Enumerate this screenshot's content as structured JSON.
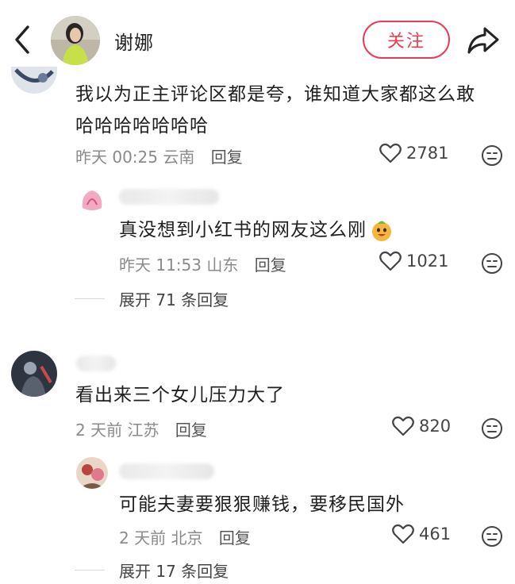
{
  "header": {
    "author_name": "谢娜",
    "follow_label": "关注",
    "icons": {
      "back": "back-arrow-icon",
      "share": "share-icon"
    }
  },
  "comments": [
    {
      "text_line1": "我以为正主评论区都是夸，谁知道大家都这么敢",
      "text_line2": "哈哈哈哈哈哈哈",
      "time": "昨天 00:25",
      "location": "云南",
      "reply_label": "回复",
      "likes": "2781",
      "reply": {
        "text": "真没想到小红书的网友这么刚",
        "time": "昨天 11:53",
        "location": "山东",
        "reply_label": "回复",
        "likes": "1021"
      },
      "expand_label": "展开 71 条回复"
    },
    {
      "text": "看出来三个女儿压力大了",
      "time": "2 天前",
      "location": "江苏",
      "reply_label": "回复",
      "likes": "820",
      "reply": {
        "text": "可能夫妻要狠狠赚钱，要移民国外",
        "time": "2 天前",
        "location": "北京",
        "reply_label": "回复",
        "likes": "461"
      },
      "expand_label": "展开 17 条回复"
    }
  ],
  "colors": {
    "accent": "#ee3a55",
    "meta": "#8a8a8a",
    "text": "#1f1f1f"
  }
}
